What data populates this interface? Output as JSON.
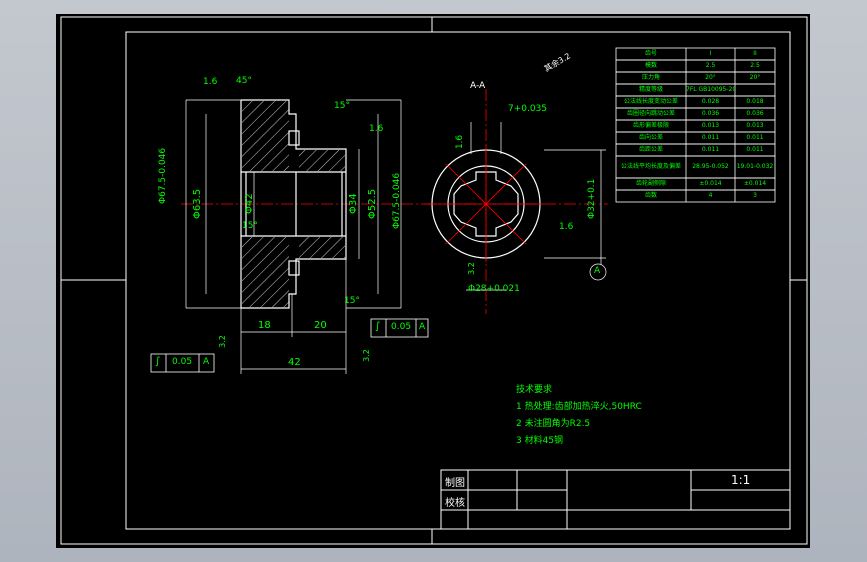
{
  "section_label": "A-A",
  "surface_finish": {
    "general": "其余3.2",
    "values": [
      "1.6",
      "1.6",
      "1.6",
      "1.6",
      "3.2",
      "3.2",
      "3.2"
    ]
  },
  "angles": [
    "45°",
    "15°",
    "15°",
    "15°"
  ],
  "dims": {
    "d_outer": "Φ67.5-0.046",
    "d_root": "Φ63.5",
    "d_bore": "Φ42",
    "d_hub": "Φ34",
    "d_shaft": "Φ52.5",
    "d_outer_right": "Φ67.5-0.046",
    "w_18": "18",
    "w_20": "20",
    "w_42": "42",
    "tol_top": "7+0.035",
    "spline_d": "Φ28+0.021",
    "spline_major": "Φ32+0.1",
    "datum": "A"
  },
  "geo_tol": [
    {
      "symbol": "∫",
      "value": "0.05",
      "datum": "A"
    },
    {
      "symbol": "∫",
      "value": "0.05",
      "datum": "A"
    }
  ],
  "gear_table": {
    "headers": [
      "齿号",
      "I",
      "II"
    ],
    "rows": [
      [
        "模数",
        "2.5",
        "2.5"
      ],
      [
        "压力角",
        "20°",
        "20°"
      ],
      [
        "精度等级",
        "7FL GB10095-2001",
        ""
      ],
      [
        "公法线长度变动公差",
        "0.028",
        "0.018"
      ],
      [
        "齿圈径向跳动公差",
        "0.036",
        "0.036"
      ],
      [
        "齿形偏差极限",
        "0.013",
        "0.013"
      ],
      [
        "齿向公差",
        "0.011",
        "0.011"
      ],
      [
        "齿距公差",
        "0.011",
        "0.011"
      ],
      [
        "公法线平均长度及偏差",
        "28.95-0.052",
        "19.01-0.032"
      ],
      [
        "齿轮副侧隙",
        "±0.014",
        "±0.014"
      ],
      [
        "齿数",
        "4",
        "3"
      ]
    ]
  },
  "requirements": {
    "title": "技术要求",
    "items": [
      "1 热处理:齿部加热淬火,50HRC",
      "2 未注圆角为R2.5",
      "3 材料45钢"
    ]
  },
  "title_block": {
    "drawn": "制图",
    "checked": "校核",
    "scale": "1:1"
  },
  "colors": {
    "line": "#ffffff",
    "text": "#00ff00",
    "center": "#ff0000",
    "hatch": "#ffffff",
    "dim": "#ffffff"
  }
}
